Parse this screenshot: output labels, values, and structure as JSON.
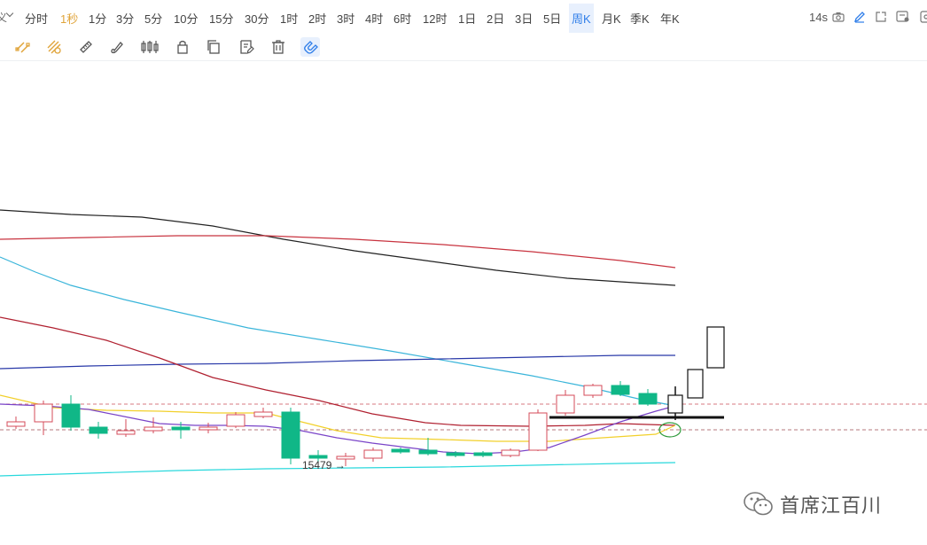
{
  "toolbar": {
    "lead_glyph": "义",
    "periods": [
      {
        "label": "分时",
        "state": "normal"
      },
      {
        "label": "1秒",
        "state": "orange"
      },
      {
        "label": "1分",
        "state": "normal"
      },
      {
        "label": "3分",
        "state": "normal"
      },
      {
        "label": "5分",
        "state": "normal"
      },
      {
        "label": "10分",
        "state": "normal"
      },
      {
        "label": "15分",
        "state": "normal"
      },
      {
        "label": "30分",
        "state": "normal"
      },
      {
        "label": "1时",
        "state": "normal"
      },
      {
        "label": "2时",
        "state": "normal"
      },
      {
        "label": "3时",
        "state": "normal"
      },
      {
        "label": "4时",
        "state": "normal"
      },
      {
        "label": "6时",
        "state": "normal"
      },
      {
        "label": "12时",
        "state": "normal"
      },
      {
        "label": "1日",
        "state": "normal"
      },
      {
        "label": "2日",
        "state": "normal"
      },
      {
        "label": "3日",
        "state": "normal"
      },
      {
        "label": "5日",
        "state": "normal"
      },
      {
        "label": "周K",
        "state": "selected"
      },
      {
        "label": "月K",
        "state": "normal"
      },
      {
        "label": "季K",
        "state": "normal"
      },
      {
        "label": "年K",
        "state": "normal"
      }
    ],
    "right": {
      "countdown": "14s",
      "icons": [
        "camera-icon",
        "edit-icon",
        "popout-icon",
        "settings-icon",
        "more-icon"
      ]
    }
  },
  "draw_tools": [
    "parallel-channel-icon",
    "fib-channel-icon",
    "ruler-icon",
    "brush-icon",
    "candle-tool-icon",
    "lock-icon",
    "copy-icon",
    "note-icon",
    "trash-icon",
    "magnet-icon"
  ],
  "colors": {
    "up": "#d44b5a",
    "down": "#10b787",
    "active_orange": "#e0a43a",
    "active_blue": "#2f7ee9",
    "ma_black": "#222222",
    "ma_red": "#c8333f",
    "ma_skyblue": "#3ab5da",
    "ma_navy": "#2838a8",
    "ma_darkred": "#b02030",
    "ma_yellow": "#f2d02b",
    "ma_purple": "#7a44c8",
    "ma_cyan": "#28d8dc"
  },
  "chart": {
    "low_label": "15479",
    "low_arrow": "→",
    "watermark": "首席江百川"
  }
}
